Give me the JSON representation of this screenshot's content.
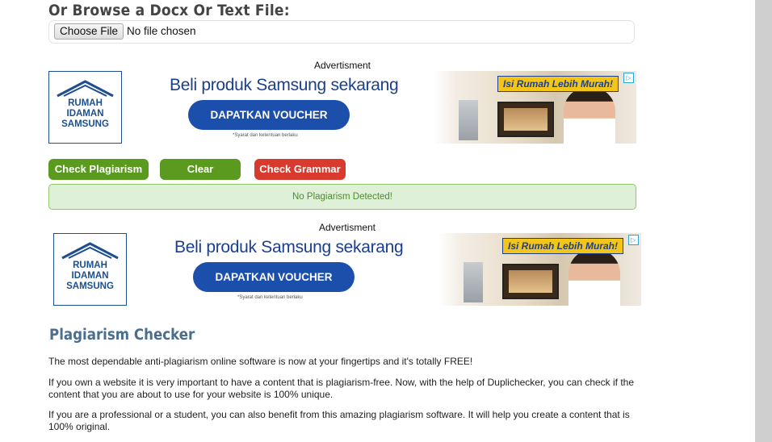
{
  "browse": {
    "title": "Or Browse a Docx Or Text File:",
    "choose_label": "Choose File",
    "file_status": "No file chosen"
  },
  "ads": [
    {
      "label": "Advertisment",
      "logo_text": [
        "RUMAH",
        "IDAMAN",
        "SAMSUNG"
      ],
      "headline": "Beli produk Samsung sekarang",
      "cta": "DAPATKAN VOUCHER",
      "fineprint": "*Syarat dan ketentuan berlaku",
      "promo": "Isi Rumah Lebih Murah!"
    },
    {
      "label": "Advertisment",
      "logo_text": [
        "RUMAH",
        "IDAMAN",
        "SAMSUNG"
      ],
      "headline": "Beli produk Samsung sekarang",
      "cta": "DAPATKAN VOUCHER",
      "fineprint": "*Syarat dan ketentuan berlaku",
      "promo": "Isi Rumah Lebih Murah!"
    }
  ],
  "actions": {
    "check": "Check Plagiarism",
    "clear": "Clear",
    "grammar": "Check Grammar"
  },
  "result": "No Plagiarism Detected!",
  "article": {
    "title": "Plagiarism Checker",
    "p1": "The most dependable anti-plagiarism online software is now at your fingertips and it's totally FREE!",
    "p2": "If you own a website it is very important to have a content that is plagiarism-free. Now, with the help of Duplichecker, you can check if the content that you are about to use for your website is 100% unique.",
    "p3": "If you are a professional or a student, you can also benefit from this amazing plagiarism software. It will help you create a content that is 100% original."
  },
  "colors": {
    "button_green": "#5a9a1e",
    "button_red": "#d83b2e",
    "result_bg": "#dff0d8",
    "title_blue": "#4b6e8e"
  }
}
